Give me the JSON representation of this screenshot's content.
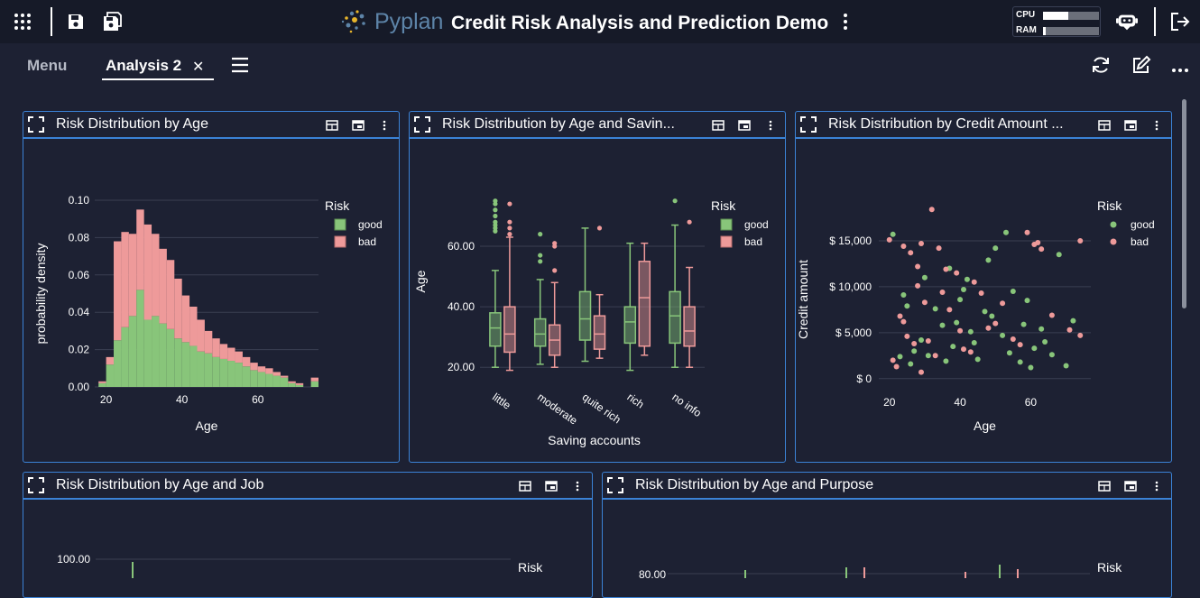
{
  "app": {
    "logo_text": "Pyplan",
    "title": "Credit Risk Analysis and Prediction Demo",
    "cpu_label": "CPU",
    "ram_label": "RAM",
    "cpu_usage": 0.45,
    "ram_usage": 0.05
  },
  "tabs": {
    "menu_label": "Menu",
    "active_label": "Analysis 2",
    "close_symbol": "✕"
  },
  "icons": {
    "apps": "grid-icon",
    "save": "save-icon",
    "save_as": "save-as-icon",
    "kebab": "more-vertical-icon",
    "assistant": "robot-icon",
    "logout": "logout-icon",
    "hamburger": "hamburger-icon",
    "refresh": "refresh-icon",
    "edit": "edit-icon",
    "more": "more-horizontal-icon",
    "expand": "expand-icon",
    "table": "table-icon",
    "window": "window-icon"
  },
  "colors": {
    "good": "#88c57a",
    "bad": "#ee9a9a",
    "panel_border": "#3b82d6",
    "background": "#1d2133",
    "topbar": "#161a28"
  },
  "panels": [
    {
      "title": "Risk Distribution by Age"
    },
    {
      "title": "Risk Distribution by Age and Savin..."
    },
    {
      "title": "Risk Distribution by Credit Amount ..."
    },
    {
      "title": "Risk Distribution by Age and Job"
    },
    {
      "title": "Risk Distribution by Age and Purpose"
    }
  ],
  "chart_data": [
    {
      "type": "bar",
      "subtype": "histogram-stacked",
      "xlabel": "Age",
      "ylabel": "probability density",
      "ylim": [
        0,
        0.1
      ],
      "y_ticks": [
        "0.00",
        "0.02",
        "0.04",
        "0.06",
        "0.08",
        "0.10"
      ],
      "x_ticks": [
        "20",
        "40",
        "60"
      ],
      "legend_title": "Risk",
      "legend_position": "top-right",
      "x": [
        18,
        20,
        22,
        24,
        26,
        28,
        30,
        32,
        34,
        36,
        38,
        40,
        42,
        44,
        46,
        48,
        50,
        52,
        54,
        56,
        58,
        60,
        62,
        64,
        66,
        68,
        70,
        72,
        74
      ],
      "series": [
        {
          "name": "good",
          "color": "#88c57a",
          "values": [
            0.002,
            0.012,
            0.025,
            0.032,
            0.038,
            0.052,
            0.036,
            0.038,
            0.034,
            0.031,
            0.026,
            0.024,
            0.022,
            0.019,
            0.018,
            0.016,
            0.015,
            0.014,
            0.013,
            0.011,
            0.009,
            0.008,
            0.007,
            0.006,
            0.005,
            0.002,
            0.001,
            0.0,
            0.003
          ]
        },
        {
          "name": "bad",
          "color": "#ee9a9a",
          "values": [
            0.001,
            0.004,
            0.053,
            0.051,
            0.044,
            0.043,
            0.051,
            0.044,
            0.04,
            0.037,
            0.032,
            0.025,
            0.021,
            0.017,
            0.012,
            0.01,
            0.008,
            0.007,
            0.006,
            0.005,
            0.004,
            0.003,
            0.003,
            0.002,
            0.001,
            0.001,
            0.001,
            0.0,
            0.002
          ]
        }
      ]
    },
    {
      "type": "box",
      "xlabel": "Saving accounts",
      "ylabel": "Age",
      "y_ticks": [
        "20.00",
        "40.00",
        "60.00"
      ],
      "ylim": [
        15,
        77
      ],
      "categories": [
        "little",
        "moderate",
        "quite rich",
        "rich",
        "no info"
      ],
      "legend_title": "Risk",
      "legend_position": "top-right",
      "series": [
        {
          "name": "good",
          "color": "#88c57a",
          "boxes": [
            {
              "min": 20,
              "q1": 27,
              "median": 33,
              "q3": 38,
              "max": 52,
              "outliers": [
                65,
                66,
                67,
                68,
                70,
                72,
                74,
                75
              ]
            },
            {
              "min": 21,
              "q1": 27,
              "median": 31,
              "q3": 36,
              "max": 49,
              "outliers": [
                55,
                57,
                64
              ]
            },
            {
              "min": 22,
              "q1": 29,
              "median": 36,
              "q3": 45,
              "max": 66,
              "outliers": []
            },
            {
              "min": 19,
              "q1": 28,
              "median": 35,
              "q3": 40,
              "max": 61,
              "outliers": []
            },
            {
              "min": 20,
              "q1": 28,
              "median": 37,
              "q3": 45,
              "max": 67,
              "outliers": [
                75
              ]
            }
          ]
        },
        {
          "name": "bad",
          "color": "#ee9a9a",
          "boxes": [
            {
              "min": 19,
              "q1": 25,
              "median": 31,
              "q3": 40,
              "max": 63,
              "outliers": [
                64,
                66,
                68,
                74
              ]
            },
            {
              "min": 20,
              "q1": 24,
              "median": 29,
              "q3": 34,
              "max": 48,
              "outliers": [
                52,
                60,
                61
              ]
            },
            {
              "min": 23,
              "q1": 26,
              "median": 31,
              "q3": 37,
              "max": 44,
              "outliers": [
                66
              ]
            },
            {
              "min": 24,
              "q1": 27,
              "median": 43,
              "q3": 55,
              "max": 61,
              "outliers": []
            },
            {
              "min": 20,
              "q1": 27,
              "median": 32,
              "q3": 40,
              "max": 53,
              "outliers": [
                68
              ]
            }
          ]
        }
      ]
    },
    {
      "type": "scatter",
      "xlabel": "Age",
      "ylabel": "Credit amount",
      "x_ticks": [
        "20",
        "40",
        "60"
      ],
      "y_ticks": [
        "$ 0",
        "$ 5,000",
        "$ 10,000",
        "$ 15,000"
      ],
      "xlim": [
        17,
        77
      ],
      "ylim": [
        -1200,
        20000
      ],
      "legend_title": "Risk",
      "legend_position": "top-right",
      "series": [
        {
          "name": "good",
          "color": "#88c57a",
          "points": [
            [
              21,
              15700
            ],
            [
              42,
              10800
            ],
            [
              53,
              15900
            ],
            [
              68,
              13500
            ],
            [
              48,
              12900
            ],
            [
              59,
              8500
            ],
            [
              50,
              14200
            ],
            [
              24,
              9100
            ],
            [
              39,
              6100
            ],
            [
              63,
              5400
            ],
            [
              57,
              1800
            ],
            [
              44,
              3900
            ],
            [
              31,
              2500
            ],
            [
              35,
              5800
            ],
            [
              26,
              1600
            ],
            [
              40,
              8600
            ],
            [
              66,
              2600
            ],
            [
              72,
              6300
            ],
            [
              55,
              9500
            ],
            [
              29,
              4200
            ],
            [
              47,
              7300
            ],
            [
              61,
              3300
            ],
            [
              37,
              12000
            ],
            [
              52,
              4700
            ],
            [
              27,
              3000
            ],
            [
              33,
              7600
            ],
            [
              45,
              2100
            ],
            [
              58,
              5900
            ],
            [
              23,
              2400
            ],
            [
              41,
              9700
            ],
            [
              64,
              4000
            ],
            [
              36,
              1900
            ],
            [
              49,
              6800
            ],
            [
              30,
              11000
            ],
            [
              54,
              2800
            ],
            [
              70,
              1400
            ],
            [
              43,
              5100
            ],
            [
              25,
              7900
            ],
            [
              60,
              1200
            ],
            [
              38,
              3500
            ]
          ]
        },
        {
          "name": "bad",
          "color": "#ee9a9a",
          "points": [
            [
              32,
              18400
            ],
            [
              28,
              12200
            ],
            [
              29,
              14700
            ],
            [
              20,
              15100
            ],
            [
              24,
              14400
            ],
            [
              34,
              14200
            ],
            [
              26,
              13700
            ],
            [
              59,
              15900
            ],
            [
              62,
              14800
            ],
            [
              61,
              14600
            ],
            [
              63,
              14100
            ],
            [
              74,
              15000
            ],
            [
              71,
              5300
            ],
            [
              74,
              4700
            ],
            [
              66,
              6900
            ],
            [
              39,
              11500
            ],
            [
              44,
              10500
            ],
            [
              35,
              9400
            ],
            [
              23,
              6800
            ],
            [
              30,
              8300
            ],
            [
              25,
              4600
            ],
            [
              21,
              2000
            ],
            [
              27,
              3800
            ],
            [
              37,
              7500
            ],
            [
              46,
              9300
            ],
            [
              50,
              6000
            ],
            [
              55,
              4300
            ],
            [
              22,
              1300
            ],
            [
              33,
              2500
            ],
            [
              41,
              3200
            ],
            [
              48,
              5500
            ],
            [
              28,
              10100
            ],
            [
              36,
              11900
            ],
            [
              31,
              4100
            ],
            [
              52,
              8200
            ],
            [
              57,
              3700
            ],
            [
              24,
              6200
            ],
            [
              43,
              2900
            ],
            [
              29,
              700
            ],
            [
              40,
              5200
            ]
          ]
        }
      ]
    },
    {
      "type": "bar",
      "y_ticks": [
        "100.00"
      ],
      "legend_title": "Risk",
      "legend_position": "top-right"
    },
    {
      "type": "bar",
      "y_ticks": [
        "80.00"
      ],
      "legend_title": "Risk",
      "legend_position": "top-right"
    }
  ]
}
